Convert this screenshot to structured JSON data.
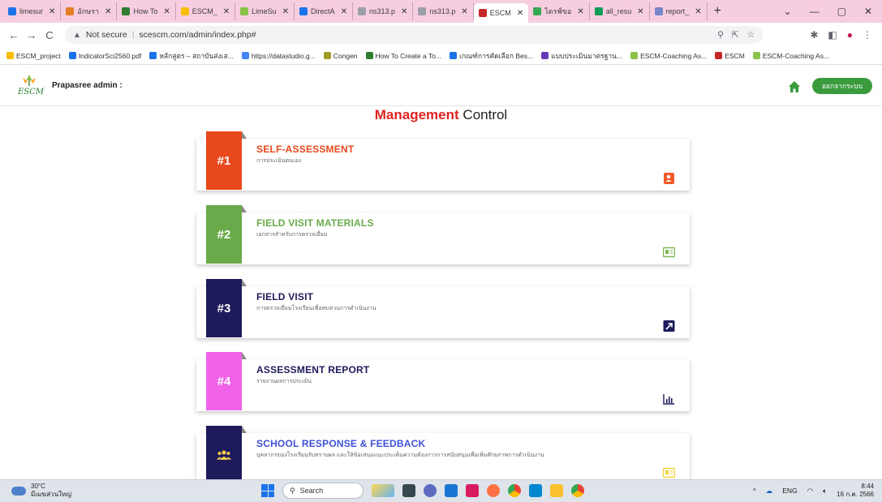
{
  "browser": {
    "tabs": [
      {
        "label": "limesur",
        "color": "#1a73e8"
      },
      {
        "label": "อักษรา",
        "color": "#e67e22"
      },
      {
        "label": "How To",
        "color": "#2e7d32"
      },
      {
        "label": "ESCM_",
        "color": "#fbbc04"
      },
      {
        "label": "LimeSu",
        "color": "#8bc34a"
      },
      {
        "label": "DirectA",
        "color": "#1a73e8"
      },
      {
        "label": "ns313.p",
        "color": "#9aa0a6"
      },
      {
        "label": "ns313.p",
        "color": "#9aa0a6"
      },
      {
        "label": "ESCM",
        "color": "#c62828",
        "active": true
      },
      {
        "label": "ไดรฟ์ขอ",
        "color": "#34a853"
      },
      {
        "label": "all_resu",
        "color": "#0f9d58"
      },
      {
        "label": "report_",
        "color": "#7986cb"
      }
    ],
    "url_warning": "Not secure",
    "url": "scescm.com/admin/index.php#",
    "bookmarks": [
      {
        "label": "ESCM_project",
        "color": "#fbbc04"
      },
      {
        "label": "IndicatorSci2560.pdf",
        "color": "#1a73e8"
      },
      {
        "label": "หลักสูตร – สถาบันส่งเส...",
        "color": "#1a73e8"
      },
      {
        "label": "https://datastudio.g...",
        "color": "#4285f4"
      },
      {
        "label": "Congen",
        "color": "#9e9d24"
      },
      {
        "label": "How To Create a To...",
        "color": "#2e7d32"
      },
      {
        "label": "เกณฑ์การคัดเลือก Bes...",
        "color": "#1a73e8"
      },
      {
        "label": "แบบประเมินมาตรฐาน...",
        "color": "#673ab7"
      },
      {
        "label": "ESCM-Coaching As...",
        "color": "#8bc34a"
      },
      {
        "label": "ESCM",
        "color": "#c62828"
      },
      {
        "label": "ESCM-Coaching As...",
        "color": "#8bc34a"
      }
    ]
  },
  "header": {
    "admin_name": "Prapasree admin :",
    "logout_label": "ออกจากระบบ"
  },
  "title": {
    "highlight": "Management",
    "rest": " Control"
  },
  "cards": [
    {
      "number": "#1",
      "title": "SELF-ASSESSMENT",
      "subtitle": "การประเมินตนเอง",
      "badge_color": "#e8491d",
      "title_color": "#e8491d",
      "icon": "contact-card-icon",
      "icon_color": "#f05a28"
    },
    {
      "number": "#2",
      "title": "FIELD VISIT MATERIALS",
      "subtitle": "เอกสารสำหรับการตรวจเยี่ยม",
      "badge_color": "#6aaa4b",
      "title_color": "#6aaa4b",
      "icon": "id-card-icon",
      "icon_color": "#7cb857"
    },
    {
      "number": "#3",
      "title": "FIELD VISIT",
      "subtitle": "การตรวจเยี่ยมโรงเรียนเพื่อทบทวนการดำเนินงาน",
      "badge_color": "#1e1b5c",
      "title_color": "#1e1b5c",
      "icon": "external-link-icon",
      "icon_color": "#1e1b5c"
    },
    {
      "number": "#4",
      "title": "ASSESSMENT REPORT",
      "subtitle": "รายงานผลการประเมิน",
      "badge_color": "#f062e8",
      "title_color": "#1e1b5c",
      "icon": "bar-chart-icon",
      "icon_color": "#1e1b5c"
    },
    {
      "number": "",
      "title": "SCHOOL RESPONSE & FEEDBACK",
      "subtitle": "บุคลากรของโรงเรียนรับทราบผล และให้ข้อเสนอแนะประเด็นความต้องการการสนับสนุนเพื่อเพิ่มศักยภาพการดำเนินงาน",
      "badge_color": "#1e1b5c",
      "title_color": "#3f51d6",
      "icon": "id-card-icon",
      "icon_color": "#f2d33a"
    }
  ],
  "taskbar": {
    "temperature": "30°C",
    "weather": "มีเมฆส่วนใหญ่",
    "search_label": "Search",
    "lang": "ENG",
    "time": "8:44",
    "date": "16 ก.ค. 2566"
  }
}
